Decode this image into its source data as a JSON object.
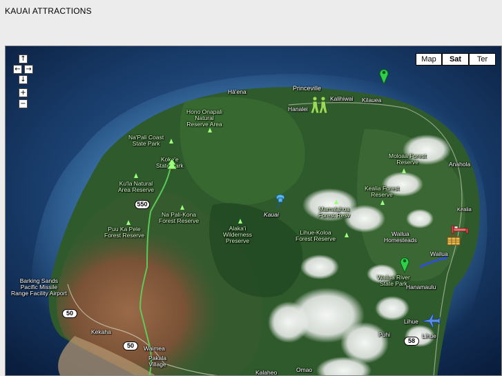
{
  "page": {
    "title": "KAUAI ATTRACTIONS"
  },
  "controls": {
    "pan_up": "↑",
    "pan_left": "←",
    "pan_right": "→",
    "pan_down": "↓",
    "zoom_in": "+",
    "zoom_out": "−"
  },
  "map_types": {
    "map": "Map",
    "sat": "Sat",
    "ter": "Ter",
    "active": "Sat"
  },
  "labels": {
    "haena": "Hā'ena",
    "princeville": "Princeville",
    "hanalei": "Hanalei",
    "kalihiwai": "Kalihiwai",
    "kilauea": "Kilauea",
    "hono_onapali": "Hono Onapali\nNatural\nReserve Area",
    "napali_coast": "Na'Pali Coast\nState Park",
    "kokee": "Koke'e\nState Park",
    "kula": "Ku'la Natural\nArea Reserve",
    "moloaa": "Moloaa Forest\nReserve",
    "anahola": "Anahola",
    "kealia_forest": "Kealia Forest\nReserve",
    "kealia": "Kealia",
    "napali_kona": "Na Pali-Kona\nForest Reserve",
    "kauai": "Kauai",
    "mamalahoa": "Mamalahoa\nForest Resv",
    "alakai": "Alaka'i\nWilderness\nPreserve",
    "puu_ka_pele": "Puu Ka Pele\nForest Reserve",
    "lihue_koloa": "Lihue-Koloa\nForest Reserve",
    "wailua_homesteads": "Wailua\nHomesteads",
    "wailua": "Wailua",
    "barking_sands": "Barking Sands\nPacific Missile\nRange Facility Airport",
    "wailua_river": "Wailua River\nState Park",
    "hanamaulu": "Hanamaulu",
    "lihue_town": "Lihue",
    "lihue_airport": "Lihue",
    "kekaha": "Kekaha",
    "puhi": "Puhi",
    "waimea": "Waimea",
    "pakala": "Pakala\nVillage",
    "kalaheo": "Kalaheo",
    "omao": "Omao"
  },
  "shields": {
    "r550": "550",
    "r50a": "50",
    "r50b": "50",
    "r58": "58"
  },
  "icons": {
    "pin_green": "green-location-marker",
    "pin_blue": "blue-pushpin-marker",
    "hiker": "hiker-icon",
    "airplane": "airplane-icon",
    "picnic": "picnic-basket-icon",
    "bed": "lodging-bed-icon",
    "tree": "park-tree-icon"
  },
  "colors": {
    "ocean_deep": "#0a2246",
    "ocean_shallow": "#2a5a8c",
    "land_green": "#2f5a2c",
    "land_red": "#8a5a3c",
    "trail": "#5cd65c",
    "marker_green": "#2fcf4a",
    "marker_blue": "#5ab8e8"
  }
}
